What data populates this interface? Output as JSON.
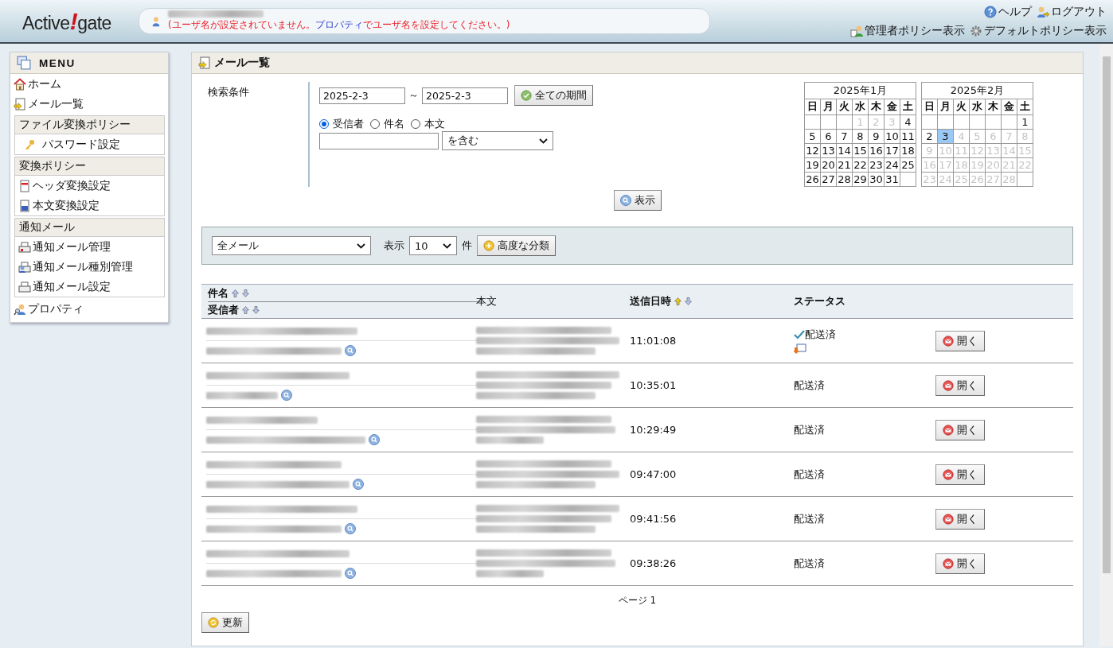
{
  "header": {
    "logo": {
      "before": "Active",
      "mark": "!",
      "after": "gate"
    },
    "user_notice": {
      "before": "(ユーザ名が設定されていません。",
      "link": "プロパティ",
      "after": "でユーザ名を設定してください。)"
    },
    "links_top": [
      {
        "label": "ヘルプ",
        "kind": "help"
      },
      {
        "label": "ログアウト",
        "kind": "logout"
      }
    ],
    "links_bottom": [
      {
        "label": "管理者ポリシー表示",
        "kind": "admin"
      },
      {
        "label": "デフォルトポリシー表示",
        "kind": "gear"
      }
    ]
  },
  "sidebar": {
    "title": "MENU",
    "top_items": [
      {
        "label": "ホーム",
        "kind": "home"
      },
      {
        "label": "メール一覧",
        "kind": "mail"
      }
    ],
    "groups": [
      {
        "title": "ファイル変換ポリシー",
        "items": [
          {
            "label": "パスワード設定",
            "kind": "key"
          }
        ]
      },
      {
        "title": "変換ポリシー",
        "items": [
          {
            "label": "ヘッダ変換設定",
            "kind": "header-doc"
          },
          {
            "label": "本文変換設定",
            "kind": "body-doc"
          }
        ]
      },
      {
        "title": "通知メール",
        "items": [
          {
            "label": "通知メール管理",
            "kind": "printer"
          },
          {
            "label": "通知メール種別管理",
            "kind": "printer-user"
          },
          {
            "label": "通知メール設定",
            "kind": "printer-plain"
          }
        ]
      }
    ],
    "bottom_items": [
      {
        "label": "プロパティ",
        "kind": "user"
      }
    ]
  },
  "panel": {
    "title": "メール一覧",
    "search": {
      "label": "検索条件",
      "date_from": "2025-2-3",
      "separator": "～",
      "date_to": "2025-2-3",
      "all_period_button": "全ての期間",
      "targets": [
        {
          "label": "受信者",
          "selected": true
        },
        {
          "label": "件名",
          "selected": false
        },
        {
          "label": "本文",
          "selected": false
        }
      ],
      "match": "を含む",
      "show_button": "表示"
    },
    "calendars": [
      {
        "title": "2025年1月",
        "weekdays": [
          "日",
          "月",
          "火",
          "水",
          "木",
          "金",
          "土"
        ],
        "weeks": [
          {
            "kind": "first",
            "days": [
              {
                "d": "1",
                "muted": true,
                "selected": false
              },
              {
                "d": "2",
                "muted": true,
                "selected": false
              },
              {
                "d": "3",
                "muted": true,
                "selected": false
              },
              {
                "d": "4",
                "muted": false,
                "selected": false
              }
            ]
          },
          [
            {
              "d": "5",
              "muted": false,
              "selected": false
            },
            {
              "d": "6",
              "muted": false,
              "selected": false
            },
            {
              "d": "7",
              "muted": false,
              "selected": false
            },
            {
              "d": "8",
              "muted": false,
              "selected": false
            },
            {
              "d": "9",
              "muted": false,
              "selected": false
            },
            {
              "d": "10",
              "muted": false,
              "selected": false
            },
            {
              "d": "11",
              "muted": false,
              "selected": false
            }
          ],
          [
            {
              "d": "12",
              "muted": false,
              "selected": false
            },
            {
              "d": "13",
              "muted": false,
              "selected": false
            },
            {
              "d": "14",
              "muted": false,
              "selected": false
            },
            {
              "d": "15",
              "muted": false,
              "selected": false
            },
            {
              "d": "16",
              "muted": false,
              "selected": false
            },
            {
              "d": "17",
              "muted": false,
              "selected": false
            },
            {
              "d": "18",
              "muted": false,
              "selected": false
            }
          ],
          [
            {
              "d": "19",
              "muted": false,
              "selected": false
            },
            {
              "d": "20",
              "muted": false,
              "selected": false
            },
            {
              "d": "21",
              "muted": false,
              "selected": false
            },
            {
              "d": "22",
              "muted": false,
              "selected": false
            },
            {
              "d": "23",
              "muted": false,
              "selected": false
            },
            {
              "d": "24",
              "muted": false,
              "selected": false
            },
            {
              "d": "25",
              "muted": false,
              "selected": false
            }
          ],
          {
            "kind": "last",
            "days": [
              {
                "d": "26",
                "muted": false,
                "selected": false
              },
              {
                "d": "27",
                "muted": false,
                "selected": false
              },
              {
                "d": "28",
                "muted": false,
                "selected": false
              },
              {
                "d": "29",
                "muted": false,
                "selected": false
              },
              {
                "d": "30",
                "muted": false,
                "selected": false
              },
              {
                "d": "31",
                "muted": false,
                "selected": false
              }
            ]
          }
        ]
      },
      {
        "title": "2025年2月",
        "weekdays": [
          "日",
          "月",
          "火",
          "水",
          "木",
          "金",
          "土"
        ],
        "weeks": [
          {
            "kind": "first",
            "days": [
              {
                "d": "1",
                "muted": false,
                "selected": false
              }
            ]
          },
          [
            {
              "d": "2",
              "muted": false,
              "selected": false
            },
            {
              "d": "3",
              "muted": false,
              "selected": true
            },
            {
              "d": "4",
              "muted": true,
              "selected": false
            },
            {
              "d": "5",
              "muted": true,
              "selected": false
            },
            {
              "d": "6",
              "muted": true,
              "selected": false
            },
            {
              "d": "7",
              "muted": true,
              "selected": false
            },
            {
              "d": "8",
              "muted": true,
              "selected": false
            }
          ],
          [
            {
              "d": "9",
              "muted": true,
              "selected": false
            },
            {
              "d": "10",
              "muted": true,
              "selected": false
            },
            {
              "d": "11",
              "muted": true,
              "selected": false
            },
            {
              "d": "12",
              "muted": true,
              "selected": false
            },
            {
              "d": "13",
              "muted": true,
              "selected": false
            },
            {
              "d": "14",
              "muted": true,
              "selected": false
            },
            {
              "d": "15",
              "muted": true,
              "selected": false
            }
          ],
          [
            {
              "d": "16",
              "muted": true,
              "selected": false
            },
            {
              "d": "17",
              "muted": true,
              "selected": false
            },
            {
              "d": "18",
              "muted": true,
              "selected": false
            },
            {
              "d": "19",
              "muted": true,
              "selected": false
            },
            {
              "d": "20",
              "muted": true,
              "selected": false
            },
            {
              "d": "21",
              "muted": true,
              "selected": false
            },
            {
              "d": "22",
              "muted": true,
              "selected": false
            }
          ],
          {
            "kind": "last",
            "days": [
              {
                "d": "23",
                "muted": true,
                "selected": false
              },
              {
                "d": "24",
                "muted": true,
                "selected": false
              },
              {
                "d": "25",
                "muted": true,
                "selected": false
              },
              {
                "d": "26",
                "muted": true,
                "selected": false
              },
              {
                "d": "27",
                "muted": true,
                "selected": false
              },
              {
                "d": "28",
                "muted": true,
                "selected": false
              }
            ]
          }
        ]
      }
    ],
    "filter": {
      "folder": "全メール",
      "show_label": "表示",
      "count": "10",
      "count_unit": "件",
      "advanced_button": "高度な分類"
    },
    "table": {
      "columns": {
        "subject": "件名",
        "recipient": "受信者",
        "body": "本文",
        "sent": "送信日時",
        "status": "ステータス"
      },
      "rows": [
        {
          "time": "11:01:08",
          "status": "配送済",
          "confirmed": true,
          "forwarded": true,
          "open": "開く"
        },
        {
          "time": "10:35:01",
          "status": "配送済",
          "confirmed": false,
          "forwarded": false,
          "open": "開く"
        },
        {
          "time": "10:29:49",
          "status": "配送済",
          "confirmed": false,
          "forwarded": false,
          "open": "開く"
        },
        {
          "time": "09:47:00",
          "status": "配送済",
          "confirmed": false,
          "forwarded": false,
          "open": "開く"
        },
        {
          "time": "09:41:56",
          "status": "配送済",
          "confirmed": false,
          "forwarded": false,
          "open": "開く"
        },
        {
          "time": "09:38:26",
          "status": "配送済",
          "confirmed": false,
          "forwarded": false,
          "open": "開く"
        }
      ]
    },
    "pager": "ページ 1",
    "refresh_button": "更新"
  }
}
